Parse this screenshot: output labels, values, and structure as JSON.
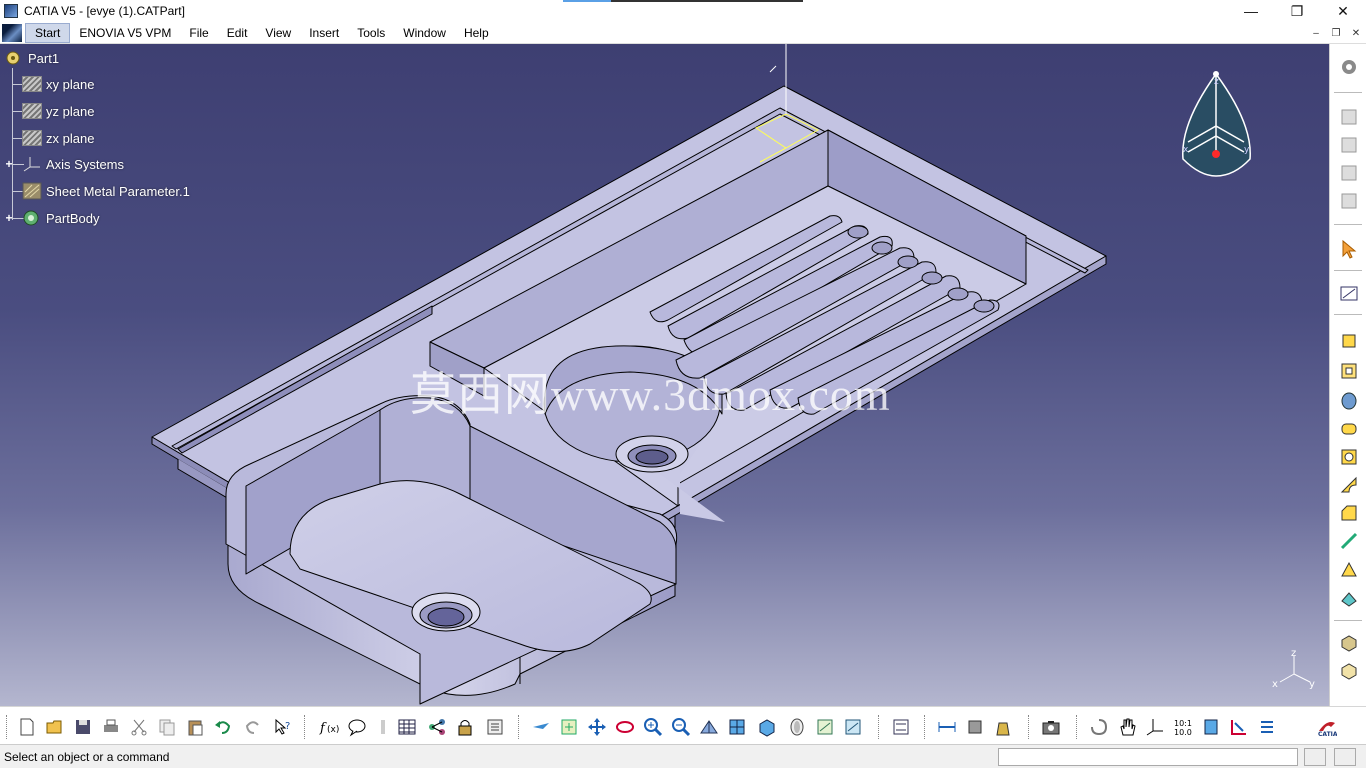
{
  "window": {
    "title": "CATIA V5 - [evye (1).CATPart]",
    "minimize": "—",
    "maximize": "❐",
    "close": "✕"
  },
  "menu": {
    "items": [
      "Start",
      "ENOVIA V5 VPM",
      "File",
      "Edit",
      "View",
      "Insert",
      "Tools",
      "Window",
      "Help"
    ],
    "active": "Start",
    "doc_minimize": "–",
    "doc_restore": "❐",
    "doc_close": "✕"
  },
  "tree": {
    "root": "Part1",
    "nodes": [
      "xy plane",
      "yz plane",
      "zx plane",
      "Axis Systems",
      "Sheet Metal Parameter.1",
      "PartBody"
    ]
  },
  "watermark": "莫西网www.3dmox.com",
  "compass": {
    "z": "z",
    "x": "x",
    "y": "y"
  },
  "axis_triad": {
    "z": "z",
    "x": "x",
    "y": "y"
  },
  "status": {
    "message": "Select an object or a command",
    "command_placeholder": ""
  },
  "colors": {
    "background_top": "#3e3f72",
    "background_bottom": "#b4b6cf",
    "model_face": "#c5c5e3",
    "model_edge": "#000000",
    "tree_text": "#ffffff"
  },
  "icons": {
    "right_toolbar": [
      "manipulate-gear-icon",
      "tool-icon-1",
      "tool-icon-2",
      "tool-icon-3",
      "tool-icon-4",
      "select-arrow-icon",
      "sketch-icon",
      "pad-icon",
      "pocket-icon",
      "shaft-icon",
      "rib-icon",
      "hole-icon",
      "fillet-icon",
      "chamfer-icon",
      "draft-icon",
      "shell-icon",
      "thickness-icon",
      "boolean-icon",
      "measure-icon"
    ],
    "bottom_toolbar": [
      "new-icon",
      "open-icon",
      "save-icon",
      "print-icon",
      "cut-icon",
      "copy-icon",
      "paste-icon",
      "undo-icon",
      "redo-icon",
      "whats-this-icon",
      "formula-icon",
      "comment-icon",
      "knowledge-icon",
      "table-icon",
      "tree-icon",
      "lock-icon",
      "catalog-icon",
      "fly-mode-icon",
      "fit-all-icon",
      "pan-icon",
      "rotate-icon",
      "zoom-in-icon",
      "zoom-out-icon",
      "normal-view-icon",
      "views-icon",
      "render-style-icon",
      "hide-show-icon",
      "swap-space-icon",
      "sheet-icon",
      "measure-between-icon",
      "measure-item-icon",
      "measure-inertia-icon",
      "capture-icon",
      "refresh-icon",
      "hand-icon",
      "axis-icon",
      "scale-icon",
      "compass-icon",
      "constraint-icon",
      "list-icon"
    ]
  }
}
